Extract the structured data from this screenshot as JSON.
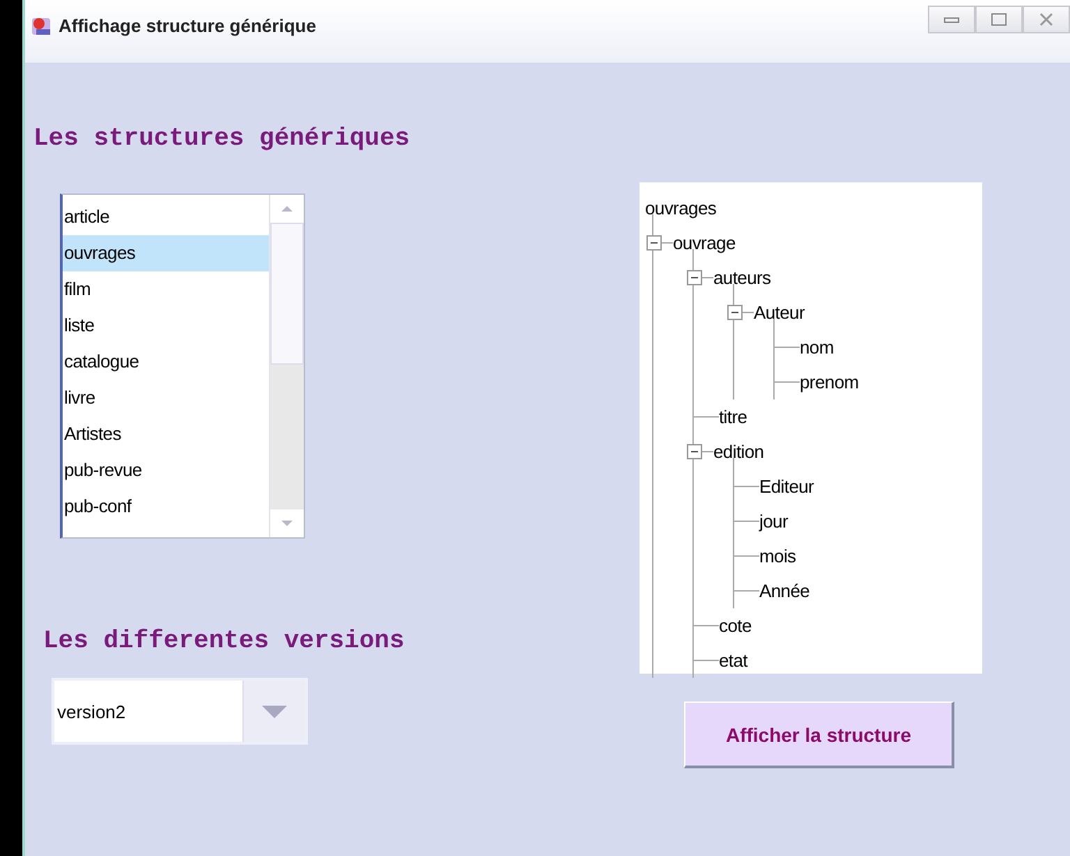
{
  "window": {
    "title": "Affichage structure générique"
  },
  "structures": {
    "heading": "Les structures génériques",
    "items": [
      {
        "label": "article",
        "selected": false
      },
      {
        "label": "ouvrages",
        "selected": true
      },
      {
        "label": "film",
        "selected": false
      },
      {
        "label": "liste",
        "selected": false
      },
      {
        "label": "catalogue",
        "selected": false
      },
      {
        "label": "livre",
        "selected": false
      },
      {
        "label": "Artistes",
        "selected": false
      },
      {
        "label": "pub-revue",
        "selected": false
      },
      {
        "label": "pub-conf",
        "selected": false
      }
    ]
  },
  "versions": {
    "heading": "Les differentes versions",
    "value": "version2"
  },
  "tree": {
    "label": "ouvrages",
    "children": [
      {
        "label": "ouvrage",
        "expanded": true,
        "children": [
          {
            "label": "auteurs",
            "expanded": true,
            "children": [
              {
                "label": "Auteur",
                "expanded": true,
                "children": [
                  {
                    "label": "nom"
                  },
                  {
                    "label": "prenom"
                  }
                ]
              }
            ]
          },
          {
            "label": "titre"
          },
          {
            "label": "edition",
            "expanded": true,
            "children": [
              {
                "label": "Editeur"
              },
              {
                "label": "jour"
              },
              {
                "label": "mois"
              },
              {
                "label": "Année"
              }
            ]
          },
          {
            "label": "cote"
          },
          {
            "label": "etat"
          }
        ]
      }
    ]
  },
  "buttons": [
    {
      "label": "Afficher la structure"
    }
  ]
}
